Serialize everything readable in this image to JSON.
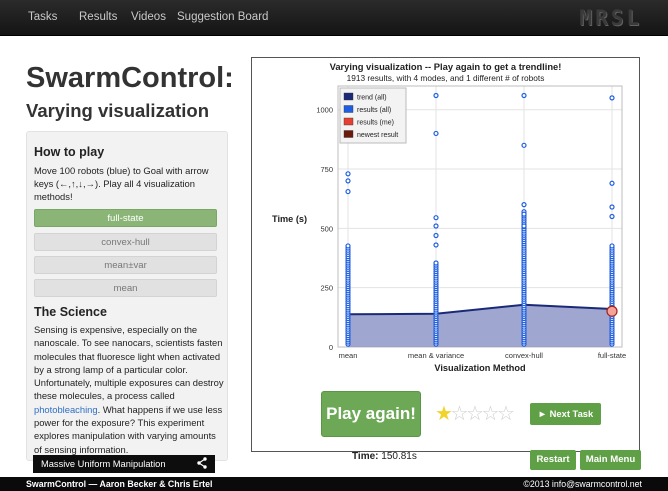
{
  "nav": {
    "items": [
      "Tasks",
      "Results",
      "Videos",
      "Suggestion Board"
    ],
    "logo": "MRSL"
  },
  "page": {
    "title": "SwarmControl:",
    "subtitle": "Varying visualization"
  },
  "how_to_play": {
    "heading": "How to play",
    "text": "Move 100 robots (blue) to Goal with arrow keys (←,↑,↓,→). Play all 4 visualization methods!",
    "methods": [
      "full-state",
      "convex-hull",
      "mean±var",
      "mean"
    ],
    "selected": "full-state"
  },
  "science": {
    "heading": "The Science",
    "text_before": "Sensing is expensive, especially on the nanoscale. To see nanocars, scientists fasten molecules that fluoresce light when activated by a strong lamp of a particular color. Unfortunately, multiple exposures can destroy these molecules, a process called ",
    "link": "photobleaching",
    "text_after": ". What happens if we use less power for the exposure? This experiment explores manipulation with varying amounts of sensing information."
  },
  "video": {
    "label": "Massive Uniform Manipulation",
    "icon": "share-icon"
  },
  "chart_data": {
    "type": "scatter",
    "title": "Varying visualization -- Play again to get a trendline!",
    "subtitle": "1913 results, with 4 modes, and 1 different # of robots",
    "xlabel": "Visualization Method",
    "ylabel": "Time (s)",
    "categories": [
      "mean",
      "mean & variance",
      "convex-hull",
      "full-state"
    ],
    "ylim": [
      0,
      1100
    ],
    "yticks": [
      0,
      250,
      500,
      750,
      1000
    ],
    "grid": true,
    "legend_position": "top-left",
    "legend": [
      {
        "label": "trend (all)",
        "color": "#1a2a78"
      },
      {
        "label": "results (all)",
        "color": "#1f5ee0"
      },
      {
        "label": "results (me)",
        "color": "#e84030"
      },
      {
        "label": "newest result",
        "color": "#6b1a0c"
      }
    ],
    "trend": {
      "name": "trend (all)",
      "values": [
        138,
        140,
        178,
        160
      ]
    },
    "results": {
      "name": "results (all)",
      "outliers": [
        [
          655,
          700,
          730
        ],
        [
          430,
          470,
          510,
          545,
          900,
          1060
        ],
        [
          510,
          560,
          600,
          850,
          1060
        ],
        [
          550,
          590,
          690,
          1050
        ]
      ],
      "dense_max": [
        430,
        360,
        570,
        430
      ]
    },
    "newest": {
      "name": "newest result",
      "category": "full-state",
      "value": 150.81
    }
  },
  "actions": {
    "play_again": "Play again!",
    "rating": 1,
    "rating_max": 5,
    "next_task": "► Next Task",
    "restart": "Restart",
    "main_menu": "Main Menu"
  },
  "time": {
    "label": "Time:",
    "value": "150.81s"
  },
  "footer": {
    "left": "SwarmControl — Aaron Becker & Chris Ertel",
    "right": "©2013 info@swarmcontrol.net"
  },
  "colors": {
    "accent_green": "#6ca855",
    "trend_fill": "#8e97c8",
    "trend_line": "#1a2a78",
    "point": "#1f5ee0"
  }
}
